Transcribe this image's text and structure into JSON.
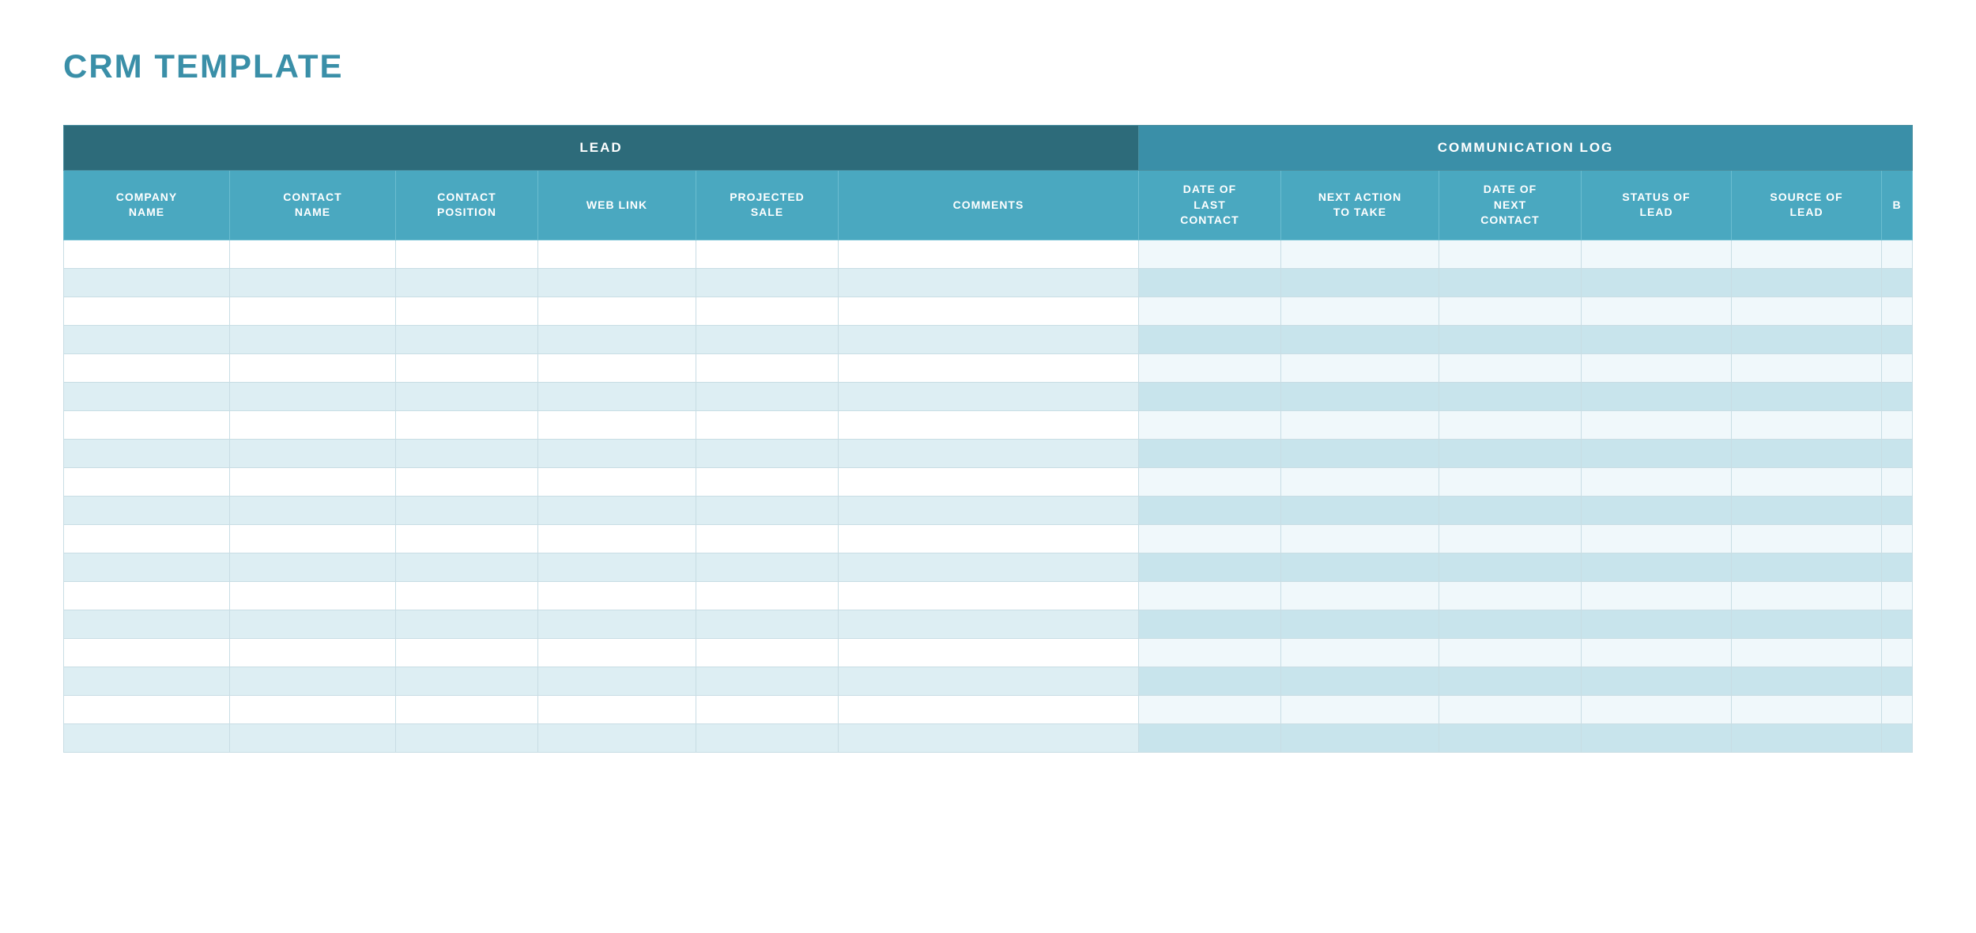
{
  "title": "CRM TEMPLATE",
  "sections": {
    "lead": {
      "label": "LEAD",
      "colspan": 6
    },
    "comm_log": {
      "label": "COMMUNICATION LOG",
      "colspan": 6
    }
  },
  "columns": [
    {
      "id": "company",
      "label": "COMPANY\nNAME",
      "class": "col-company",
      "section": "lead"
    },
    {
      "id": "contact",
      "label": "CONTACT\nNAME",
      "class": "col-contact",
      "section": "lead"
    },
    {
      "id": "position",
      "label": "CONTACT\nPOSITION",
      "class": "col-position",
      "section": "lead"
    },
    {
      "id": "weblink",
      "label": "WEB LINK",
      "class": "col-weblink",
      "section": "lead"
    },
    {
      "id": "projected",
      "label": "PROJECTED\nSALE",
      "class": "col-projected",
      "section": "lead"
    },
    {
      "id": "comments",
      "label": "COMMENTS",
      "class": "col-comments",
      "section": "lead"
    },
    {
      "id": "lastdate",
      "label": "DATE OF\nLAST\nCONTACT",
      "class": "col-lastdate",
      "section": "comm"
    },
    {
      "id": "nextaction",
      "label": "NEXT ACTION\nTO TAKE",
      "class": "col-nextaction",
      "section": "comm"
    },
    {
      "id": "nextdate",
      "label": "DATE OF\nNEXT\nCONTACT",
      "class": "col-nextdate",
      "section": "comm"
    },
    {
      "id": "status",
      "label": "STATUS OF\nLEAD",
      "class": "col-status",
      "section": "comm"
    },
    {
      "id": "source",
      "label": "SOURCE OF\nLEAD",
      "class": "col-source",
      "section": "comm"
    },
    {
      "id": "extra",
      "label": "B",
      "class": "col-extra",
      "section": "comm"
    }
  ],
  "num_rows": 18,
  "colors": {
    "title": "#3a8fa8",
    "section_header_dark": "#2d6b7a",
    "section_header_mid": "#3a8fa8",
    "col_header": "#4aa8c0",
    "row_odd_lead": "#ffffff",
    "row_even_lead": "#ddeef3",
    "row_odd_comm": "#f0f8fb",
    "row_even_comm": "#c8e4ec"
  }
}
